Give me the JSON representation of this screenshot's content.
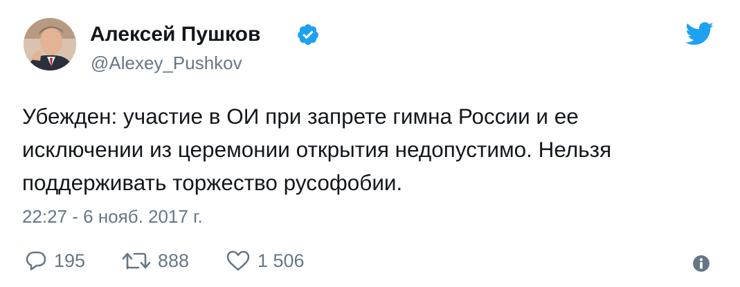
{
  "tweet": {
    "author": {
      "name": "Алексей Пушков",
      "handle": "@Alexey_Pushkov",
      "verified": true
    },
    "text_lines": [
      "Убежден: участие в ОИ при запрете гимна России и ее",
      "исключении из церемонии открытия недопустимо. Нельзя",
      "поддерживать торжество русофобии."
    ],
    "timestamp": "22:27 - 6 нояб. 2017 г.",
    "actions": {
      "replies": "195",
      "retweets": "888",
      "likes": "1 506"
    }
  },
  "icons": {
    "verified": "verified-badge-icon",
    "brand": "twitter-bird-icon",
    "reply": "reply-icon",
    "retweet": "retweet-icon",
    "like": "heart-icon",
    "info": "info-icon"
  },
  "colors": {
    "brand_blue": "#1da1f2",
    "text": "#14171a",
    "secondary": "#657786"
  }
}
